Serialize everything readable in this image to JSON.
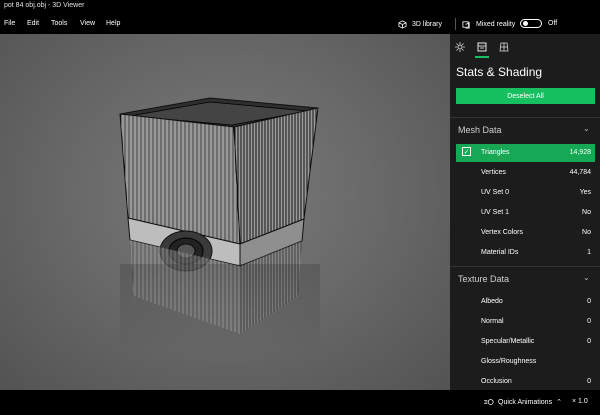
{
  "window": {
    "title": "pot 84 obj.obj - 3D Viewer"
  },
  "menu": [
    "File",
    "Edit",
    "Tools",
    "View",
    "Help"
  ],
  "toolbar": {
    "library_label": "3D library",
    "mixed_reality_label": "Mixed reality",
    "toggle_state": "Off"
  },
  "panel": {
    "tabs": [
      "environment-icon",
      "stats-icon",
      "grid-icon"
    ],
    "title": "Stats & Shading",
    "deselect_label": "Deselect All",
    "mesh": {
      "header": "Mesh Data",
      "rows": [
        {
          "label": "Triangles",
          "value": "14,928"
        },
        {
          "label": "Vertices",
          "value": "44,784"
        },
        {
          "label": "UV Set 0",
          "value": "Yes"
        },
        {
          "label": "UV Set 1",
          "value": "No"
        },
        {
          "label": "Vertex Colors",
          "value": "No"
        },
        {
          "label": "Material IDs",
          "value": "1"
        }
      ]
    },
    "texture": {
      "header": "Texture Data",
      "rows": [
        {
          "label": "Albedo",
          "value": "0"
        },
        {
          "label": "Normal",
          "value": "0"
        },
        {
          "label": "Specular/Metallic",
          "value": "0"
        },
        {
          "label": "Gloss/Roughness",
          "value": ""
        },
        {
          "label": "Occlusion",
          "value": "0"
        }
      ]
    }
  },
  "footer": {
    "animations_label": "Quick Animations",
    "zoom": "× 1.0"
  },
  "colors": {
    "accent": "#16c060",
    "panel_bg": "#1c1c1c",
    "bar_bg": "#000000"
  }
}
